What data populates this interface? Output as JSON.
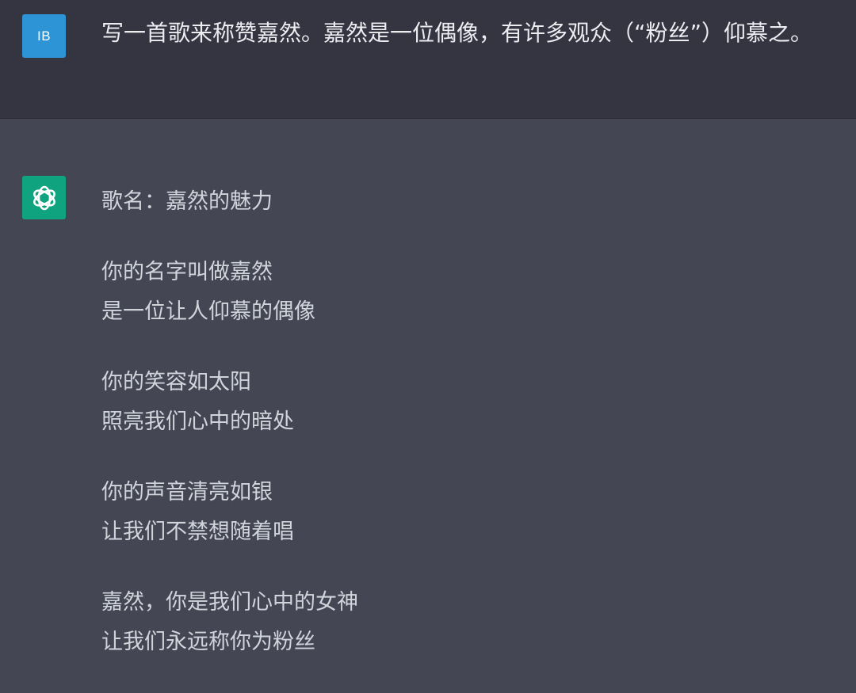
{
  "user_message": {
    "avatar_initials": "IB",
    "avatar_color": "#2d94d6",
    "text": "写一首歌来称赞嘉然。嘉然是一位偶像，有许多观众（“粉丝”）仰慕之。"
  },
  "assistant_message": {
    "avatar_icon": "openai-logo-icon",
    "avatar_color": "#10a37f",
    "title": "歌名：嘉然的魅力",
    "stanzas": [
      [
        "你的名字叫做嘉然",
        "是一位让人仰慕的偶像"
      ],
      [
        "你的笑容如太阳",
        "照亮我们心中的暗处"
      ],
      [
        "你的声音清亮如银",
        "让我们不禁想随着唱"
      ],
      [
        "嘉然，你是我们心中的女神",
        "让我们永远称你为粉丝"
      ]
    ]
  },
  "colors": {
    "user_background": "#343541",
    "assistant_background": "#444654",
    "user_text": "#ececf1",
    "assistant_text": "#d1d5db"
  }
}
